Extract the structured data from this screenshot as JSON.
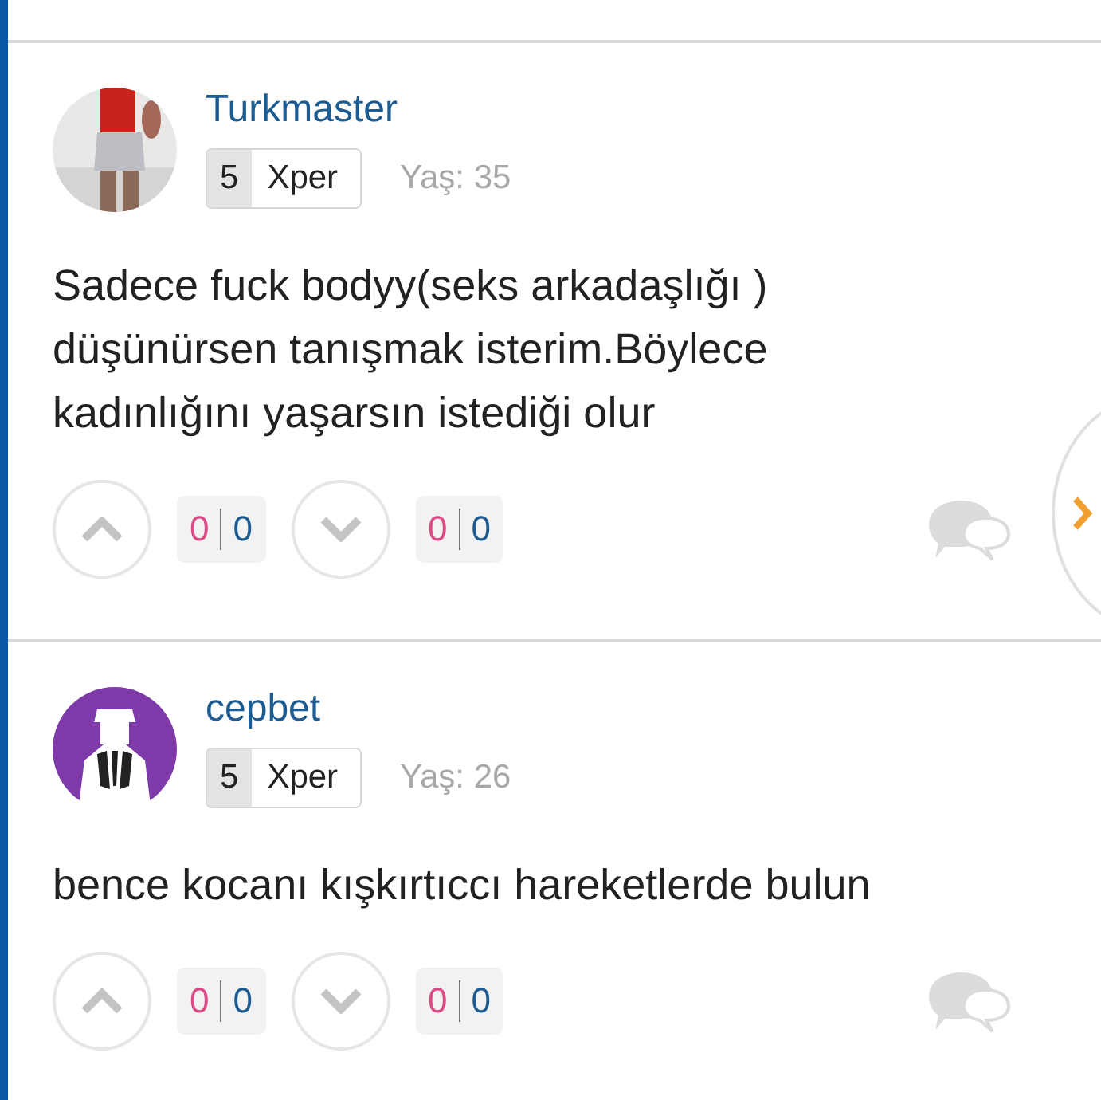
{
  "comments": [
    {
      "username": "Turkmaster",
      "xper_level": "5",
      "xper_label": "Xper",
      "age": "Yaş: 35",
      "text": "Sadece fuck bodyy(seks arkadaşlığı ) düşünürsen tanışmak isterim.Böylece kadınlığını yaşarsın istediği olur",
      "up_counts": [
        "0",
        "0"
      ],
      "down_counts": [
        "0",
        "0"
      ],
      "next_button": true
    },
    {
      "username": "cepbet",
      "avatar": {
        "kind": "silhouette"
      },
      "xper_level": "5",
      "xper_label": "Xper",
      "age": "Yaş: 26",
      "text": "bence kocanı kışkırtıccı hareketlerde bulun",
      "up_counts": [
        "0",
        "0"
      ],
      "down_counts": [
        "0",
        "0"
      ],
      "next_button": false
    }
  ]
}
